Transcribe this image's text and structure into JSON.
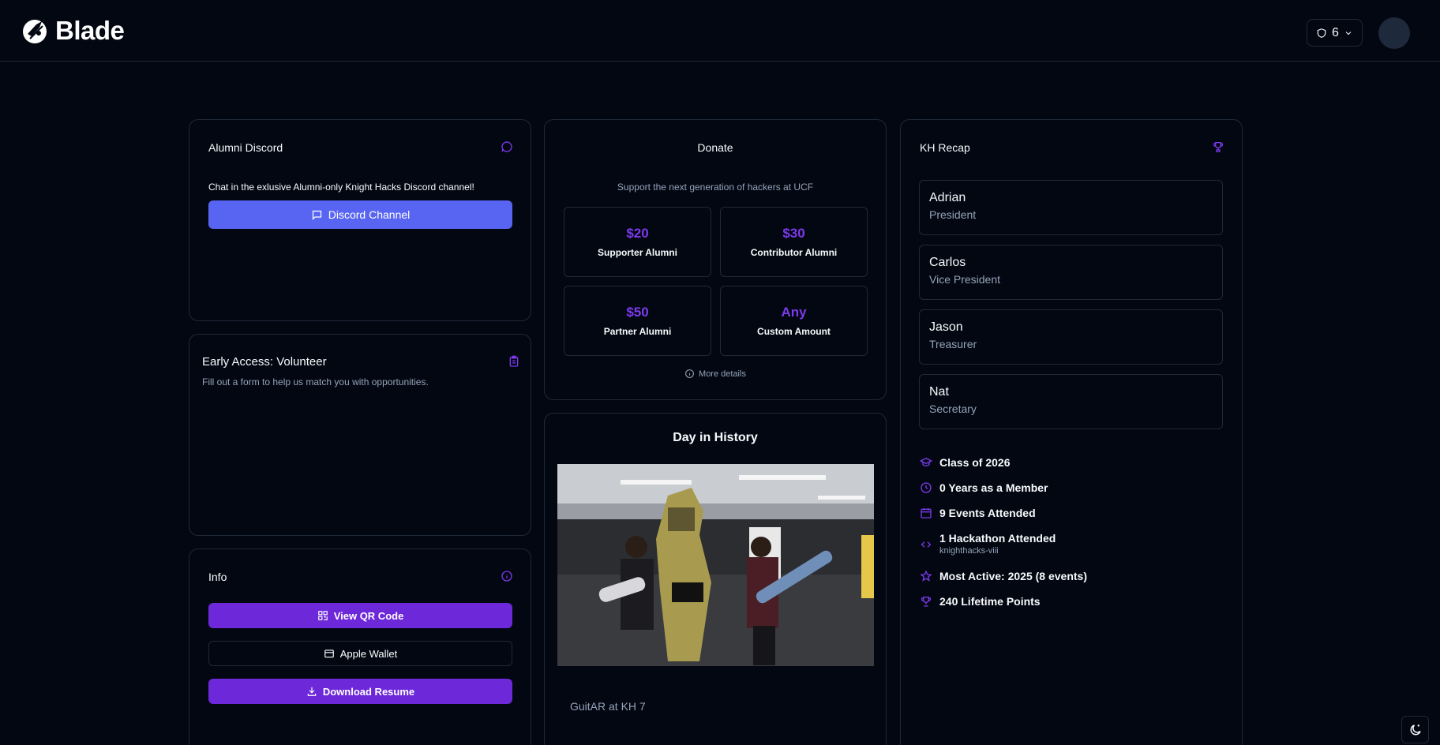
{
  "app": {
    "brand": "Blade",
    "role_count": "6"
  },
  "discord_card": {
    "title": "Alumni Discord",
    "description": "Chat in the exlusive Alumni-only Knight Hacks Discord channel!",
    "button": "Discord Channel"
  },
  "volunteer_card": {
    "title": "Early Access: Volunteer",
    "description": "Fill out a form to help us match you with opportunities."
  },
  "info_card": {
    "title": "Info",
    "qr_button": "View QR Code",
    "wallet_button": "Apple Wallet",
    "resume_button": "Download Resume"
  },
  "donate_card": {
    "title": "Donate",
    "subtitle": "Support the next generation of hackers at UCF",
    "options": [
      {
        "amount": "$20",
        "label": "Supporter Alumni"
      },
      {
        "amount": "$30",
        "label": "Contributor Alumni"
      },
      {
        "amount": "$50",
        "label": "Partner Alumni"
      },
      {
        "amount": "Any",
        "label": "Custom Amount"
      }
    ],
    "more_details": "More details"
  },
  "history_card": {
    "title": "Day in History",
    "caption": "GuitAR at KH 7"
  },
  "recap_card": {
    "title": "KH Recap",
    "officers": [
      {
        "name": "Adrian",
        "role": "President"
      },
      {
        "name": "Carlos",
        "role": "Vice President"
      },
      {
        "name": "Jason",
        "role": "Treasurer"
      },
      {
        "name": "Nat",
        "role": "Secretary"
      }
    ],
    "stats": {
      "class_of": "Class of 2026",
      "years": "0 Years as a Member",
      "events": "9 Events Attended",
      "hackathons": "1 Hackathon Attended",
      "hackathon_name": "knighthacks-viii",
      "most_active": "Most Active: 2025 (8 events)",
      "points": "240 Lifetime Points"
    }
  },
  "colors": {
    "accent": "#7c3aed",
    "discord": "#5865f2",
    "button_purple": "#6d28d9",
    "background": "#030712",
    "border": "#1f2937"
  }
}
